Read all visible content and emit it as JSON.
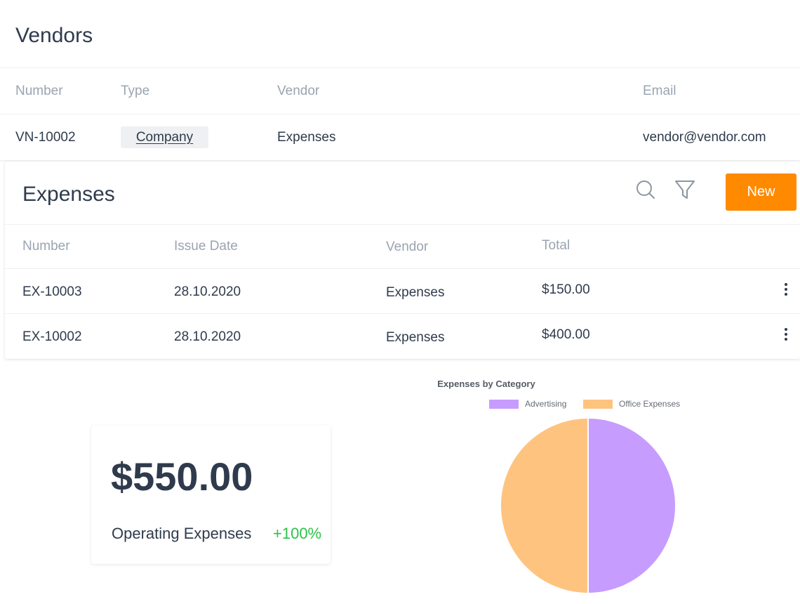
{
  "vendors": {
    "title": "Vendors",
    "columns": [
      "Number",
      "Type",
      "Vendor",
      "Email"
    ],
    "rows": [
      {
        "number": "VN-10002",
        "type": "Company",
        "vendor": "Expenses",
        "email": "vendor@vendor.com"
      }
    ]
  },
  "expenses": {
    "title": "Expenses",
    "search_icon": "search-icon",
    "filter_icon": "filter-icon",
    "new_label": "New",
    "columns": [
      "Number",
      "Issue Date",
      "Vendor",
      "Total"
    ],
    "rows": [
      {
        "number": "EX-10003",
        "issue_date": "28.10.2020",
        "vendor": "Expenses",
        "total": "$150.00"
      },
      {
        "number": "EX-10002",
        "issue_date": "28.10.2020",
        "vendor": "Expenses",
        "total": "$400.00"
      }
    ]
  },
  "kpi": {
    "amount": "$550.00",
    "label": "Operating Expenses",
    "change": "+100%",
    "change_color": "#2bc24a"
  },
  "colors": {
    "accent": "#ff8a00",
    "text": "#2f3b4d",
    "muted": "#9aa4b1"
  },
  "chart_data": {
    "type": "pie",
    "title": "Expenses by Category",
    "legend_position": "top",
    "categories": [
      "Advertising",
      "Office Expenses"
    ],
    "values": [
      50,
      50
    ],
    "colors": [
      "#c79cff",
      "#ffc380"
    ]
  }
}
